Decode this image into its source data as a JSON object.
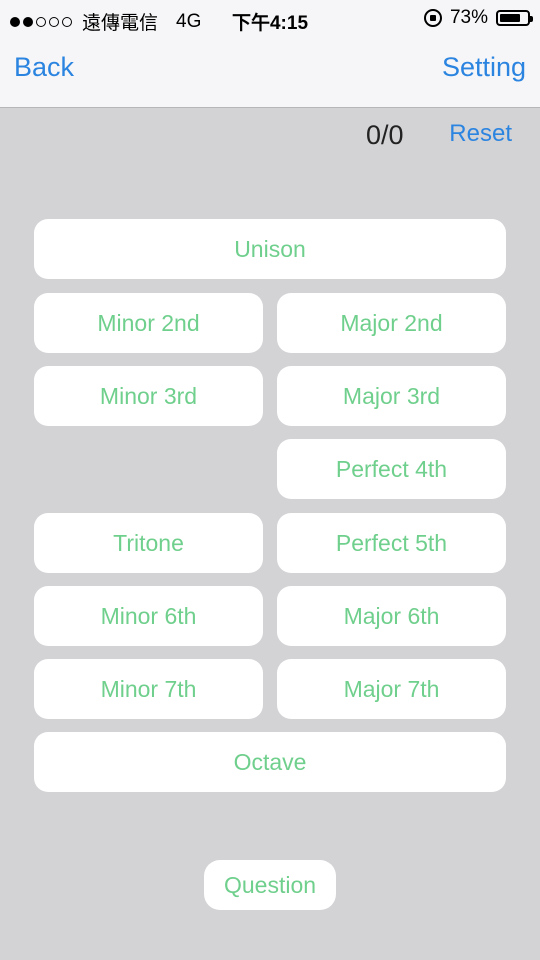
{
  "status_bar": {
    "carrier": "遠傳電信",
    "network": "4G",
    "time": "下午4:15",
    "battery_percent": "73%",
    "signal_strength": 2,
    "signal_total": 5
  },
  "nav": {
    "back_label": "Back",
    "setting_label": "Setting"
  },
  "score": {
    "value": "0/0",
    "reset_label": "Reset"
  },
  "intervals": {
    "unison": "Unison",
    "minor_2nd": "Minor 2nd",
    "major_2nd": "Major 2nd",
    "minor_3rd": "Minor 3rd",
    "major_3rd": "Major 3rd",
    "perfect_4th": "Perfect 4th",
    "tritone": "Tritone",
    "perfect_5th": "Perfect 5th",
    "minor_6th": "Minor 6th",
    "major_6th": "Major 6th",
    "minor_7th": "Minor 7th",
    "major_7th": "Major 7th",
    "octave": "Octave"
  },
  "question_label": "Question",
  "colors": {
    "accent_blue": "#2b84e0",
    "button_green": "#6fcf8c",
    "background_gray": "#d3d3d6"
  }
}
